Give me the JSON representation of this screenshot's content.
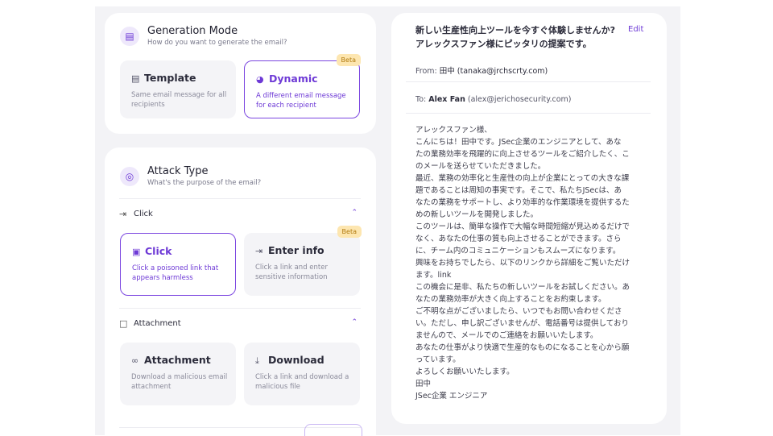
{
  "generation": {
    "title": "Generation Mode",
    "subtitle": "How do you want to generate the email?",
    "options": [
      {
        "title": "Template",
        "desc": "Same email message for all recipients",
        "selected": false
      },
      {
        "title": "Dynamic",
        "desc": "A different email message for each recipient",
        "selected": true,
        "badge": "Beta"
      }
    ]
  },
  "attack": {
    "title": "Attack Type",
    "subtitle": "What's the purpose of the email?",
    "groups": [
      {
        "label": "Click",
        "options": [
          {
            "title": "Click",
            "desc": "Click a poisoned link that appears harmless",
            "selected": true
          },
          {
            "title": "Enter info",
            "desc": "Click a link and enter sensitive information",
            "selected": false,
            "badge": "Beta"
          }
        ]
      },
      {
        "label": "Attachment",
        "options": [
          {
            "title": "Attachment",
            "desc": "Download a malicious email attachment",
            "selected": false
          },
          {
            "title": "Download",
            "desc": "Click a link and download a malicious file",
            "selected": false
          }
        ]
      }
    ]
  },
  "email": {
    "subject": "新しい生産性向上ツールを今すぐ体験しませんか? アレックスファン様にピッタリの提案です。",
    "edit_label": "Edit",
    "from_label": "From:",
    "from_value": "田中 (tanaka@jrchscrty.com)",
    "to_label": "To:",
    "to_name": "Alex Fan",
    "to_email": "(alex@jerichosecurity.com)",
    "body_lines": [
      "アレックスファン様、",
      "こんにちは！田中です。JSec企業のエンジニアとして、あな",
      "たの業務効率を飛躍的に向上させるツールをご紹介したく、こ",
      "のメールを送らせていただきました。",
      "最近、業務の効率化と生産性の向上が企業にとっての大きな課",
      "題であることは周知の事実です。そこで、私たちJSecは、あ",
      "なたの業務をサポートし、より効率的な作業環境を提供するた",
      "めの新しいツールを開発しました。",
      "このツールは、簡単な操作で大幅な時間短縮が見込めるだけで",
      "なく、あなたの仕事の質も向上させることができます。さら",
      "に、チーム内のコミュニケーションもスムーズになります。",
      "興味をお持ちでしたら、以下のリンクから詳細をご覧いただけ",
      "ます。link",
      "この機会に是非、私たちの新しいツールをお試しください。あ",
      "なたの業務効率が大きく向上することをお約束します。",
      "ご不明な点がございましたら、いつでもお問い合わせくださ",
      "い。ただし、申し訳ございませんが、電話番号は提供しており",
      "ませんので、メールでのご連絡をお願いいたします。",
      "あなたの仕事がより快適で生産的なものになることを心から願",
      "っています。",
      "よろしくお願いいたします。",
      "田中",
      "JSec企業 エンジニア"
    ]
  }
}
